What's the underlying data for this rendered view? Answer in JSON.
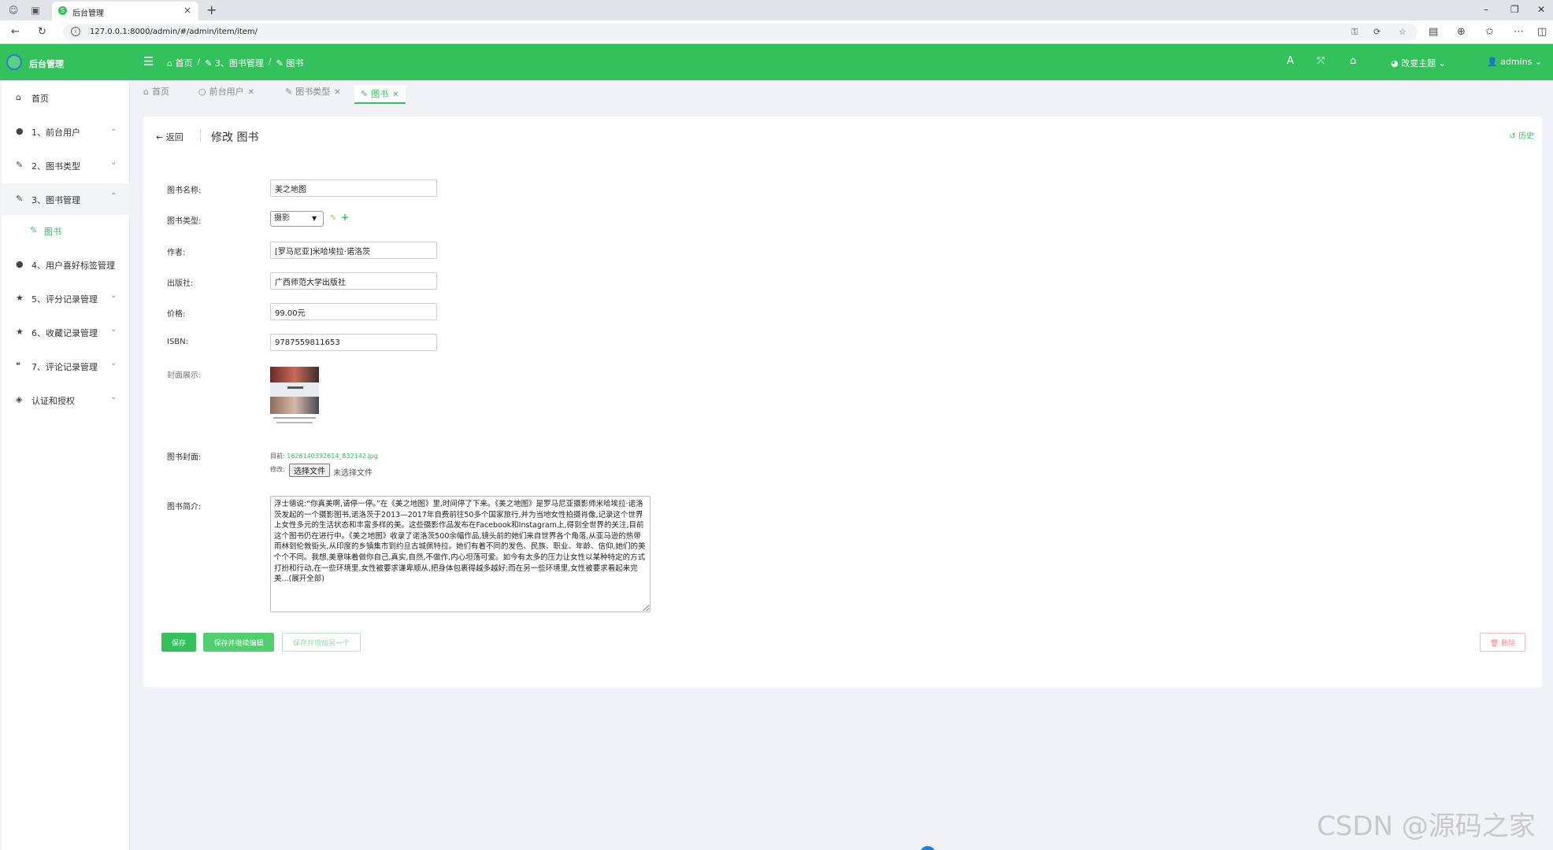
{
  "browser": {
    "tab_title": "后台管理",
    "url": "127.0.0.1:8000/admin/#/admin/item/item/"
  },
  "header": {
    "app_title": "后台管理",
    "breadcrumb": [
      "首页",
      "3、图书管理",
      "图书"
    ],
    "theme_label": "改变主题",
    "user_label": "admins"
  },
  "sidebar": {
    "items": [
      {
        "label": "首页",
        "icon": "home-icon"
      },
      {
        "label": "1、前台用户",
        "icon": "user-icon"
      },
      {
        "label": "2、图书类型",
        "icon": "pencil-icon"
      },
      {
        "label": "3、图书管理",
        "icon": "pencil-icon"
      },
      {
        "label": "4、用户喜好标签管理",
        "icon": "user-icon"
      },
      {
        "label": "5、评分记录管理",
        "icon": "star-icon"
      },
      {
        "label": "6、收藏记录管理",
        "icon": "star-icon"
      },
      {
        "label": "7、评论记录管理",
        "icon": "comments-icon"
      },
      {
        "label": "认证和授权",
        "icon": "shield-icon"
      }
    ],
    "sub_item": "图书"
  },
  "tabs": [
    {
      "label": "首页",
      "icon": "home-icon"
    },
    {
      "label": "前台用户",
      "icon": "user-icon"
    },
    {
      "label": "图书类型",
      "icon": "pencil-icon"
    },
    {
      "label": "图书",
      "icon": "pencil-icon",
      "active": true
    }
  ],
  "form": {
    "back_label": "返回",
    "title": "修改 图书",
    "history_label": "历史",
    "fields": {
      "name": {
        "label": "图书名称:",
        "value": "美之地图"
      },
      "category": {
        "label": "图书类型:",
        "value": "摄影"
      },
      "author": {
        "label": "作者:",
        "value": "[罗马尼亚]米哈埃拉·诺洛茨"
      },
      "publisher": {
        "label": "出版社:",
        "value": "广西师范大学出版社"
      },
      "price": {
        "label": "价格:",
        "value": "99.00元"
      },
      "isbn": {
        "label": "ISBN:",
        "value": "9787559811653"
      },
      "cover_display": {
        "label": "封面展示:"
      },
      "cover": {
        "label": "图书封面:",
        "current_label": "目前:",
        "current_file": "1626140392614_832142.jpg",
        "change_label": "修改:",
        "choose_button": "选择文件",
        "no_file": "未选择文件"
      },
      "description": {
        "label": "图书简介:",
        "value": "浮士德说:“你真美啊,请停一停。”在《美之地图》里,时间停了下来。《美之地图》是罗马尼亚摄影师米哈埃拉·诺洛茨发起的一个摄影图书,诺洛茨于2013—2017年自费前往50多个国家旅行,并为当地女性拍摄肖像,记录这个世界上女性多元的生活状态和丰富多样的美。这些摄影作品发布在Facebook和Instagram上,得到全世界的关注,目前这个图书仍在进行中。《美之地图》收录了诺洛茨500余幅作品,镜头前的她们来自世界各个角落,从亚马逊的热带雨林到伦敦街头,从印度的乡镇集市到约旦古城佩特拉。她们有着不同的发色、民族、职业、年龄、信仰,她们的美个个不同。我想,美意味着做你自己,真实,自然,不做作,内心坦荡可爱。如今有太多的压力让女性以某种特定的方式打扮和行动,在一些环境里,女性被要求谦卑顺从,把身体包裹得越多越好;而在另一些环境里,女性被要求看起来完美...(展开全部)"
      }
    },
    "buttons": {
      "save": "保存",
      "save_continue": "保存并继续编辑",
      "save_add": "保存并增加另一个",
      "delete": "删除"
    }
  },
  "watermark": "CSDN @源码之家",
  "colors": {
    "accent": "#33c15c",
    "danger": "#f08a8a"
  }
}
